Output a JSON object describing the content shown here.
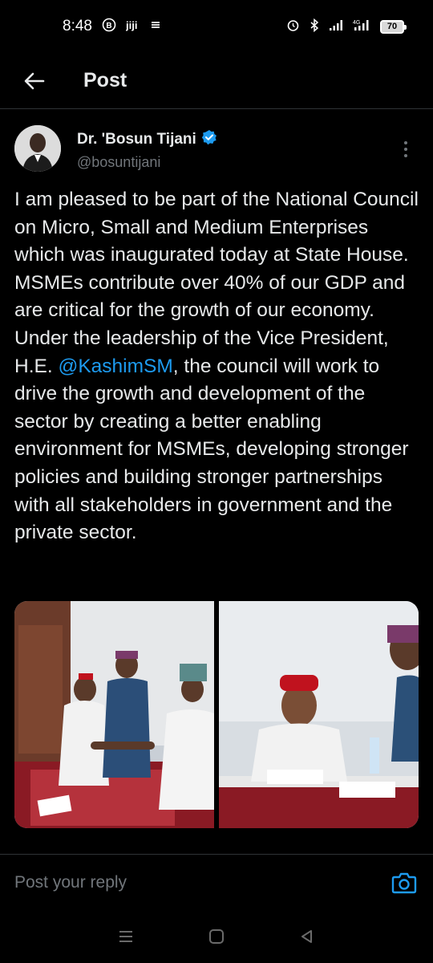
{
  "status_bar": {
    "time": "8:48",
    "battery_level": "70",
    "icons": [
      "b-circle-icon",
      "jiji-icon",
      "stack-icon",
      "alarm-icon",
      "bluetooth-icon",
      "signal-icon",
      "4g-icon",
      "signal-icon"
    ]
  },
  "header": {
    "title": "Post",
    "back_icon": "arrow-left-icon"
  },
  "post": {
    "author_name": "Dr. 'Bosun Tijani",
    "verified": true,
    "author_handle": "@bosuntijani",
    "text_before_mention": "I am pleased to be part of the National Council on Micro, Small and Medium Enterprises which was inaugurated today at State House. MSMEs contribute over 40% of our GDP and are critical for the growth of our economy. Under the leadership of the Vice President, H.E. ",
    "mention": "@KashimSM",
    "text_after_mention": ", the council will work to drive the growth and development of the sector by creating a better enabling environment for MSMEs, developing stronger policies and building stronger partnerships with all stakeholders in government and the private sector.",
    "media": [
      {
        "description_icon": "photo-handshake"
      },
      {
        "description_icon": "photo-meeting"
      }
    ]
  },
  "reply": {
    "placeholder": "Post your reply"
  },
  "colors": {
    "background": "#000000",
    "text": "#e7e9ea",
    "secondary": "#71767b",
    "accent": "#1d9bf0",
    "divider": "#2f3336"
  }
}
